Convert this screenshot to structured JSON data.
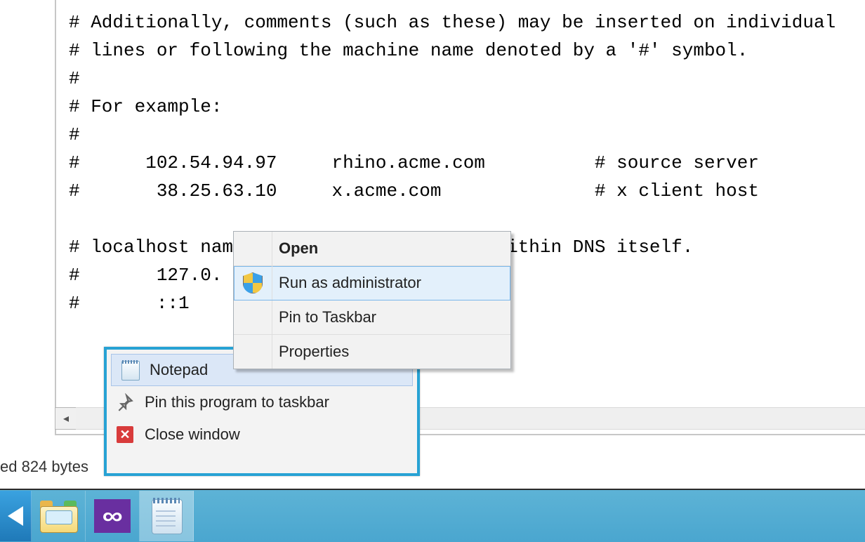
{
  "editor": {
    "content": "# Additionally, comments (such as these) may be inserted on individual\n# lines or following the machine name denoted by a '#' symbol.\n#\n# For example:\n#\n#      102.54.94.97     rhino.acme.com          # source server\n#       38.25.63.10     x.acme.com              # x client host\n\n# localhost name resolution is handled within DNS itself.\n#       127.0.\n#       ::1"
  },
  "statusbar": {
    "text": "ed  824 bytes"
  },
  "context_menu": {
    "open": "Open",
    "run_admin": "Run as administrator",
    "pin_taskbar": "Pin to Taskbar",
    "properties": "Properties"
  },
  "jump_list": {
    "app_name": "Notepad",
    "pin_label": "Pin this program to taskbar",
    "close_label": "Close window"
  },
  "taskbar": {
    "items": [
      "start",
      "file-explorer",
      "visual-studio",
      "notepad"
    ]
  }
}
